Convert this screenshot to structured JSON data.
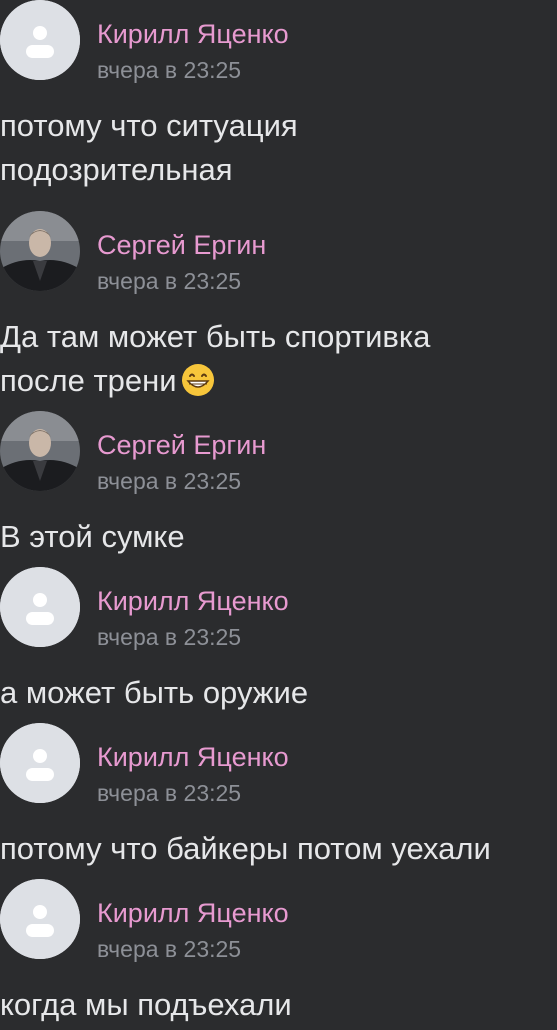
{
  "messages": [
    {
      "author": "Кирилл Яценко",
      "time": "вчера в 23:25",
      "text": "потому что ситуация\nподозрительная",
      "avatar": "default-user-icon"
    },
    {
      "author": "Сергей Ергин",
      "time": "вчера в 23:25",
      "text": "Да там может быть спортивка\nпосле трени",
      "avatar": "photo",
      "emoji": "grinning-face-emoji"
    },
    {
      "author": "Сергей Ергин",
      "time": "вчера в 23:25",
      "text": "В этой сумке",
      "avatar": "photo"
    },
    {
      "author": "Кирилл Яценко",
      "time": "вчера в 23:25",
      "text": "а может быть оружие",
      "avatar": "default-user-icon"
    },
    {
      "author": "Кирилл Яценко",
      "time": "вчера в 23:25",
      "text": "потому что байкеры потом уехали",
      "avatar": "default-user-icon"
    },
    {
      "author": "Кирилл Яценко",
      "time": "вчера в 23:25",
      "text": "когда мы подъехали",
      "avatar": "default-user-icon"
    }
  ],
  "colors": {
    "background": "#2b2c2e",
    "author_name": "#e79ad0",
    "timestamp": "#8d9097",
    "message_text": "#e6e7e9",
    "default_avatar_bg": "#dde0e5"
  }
}
